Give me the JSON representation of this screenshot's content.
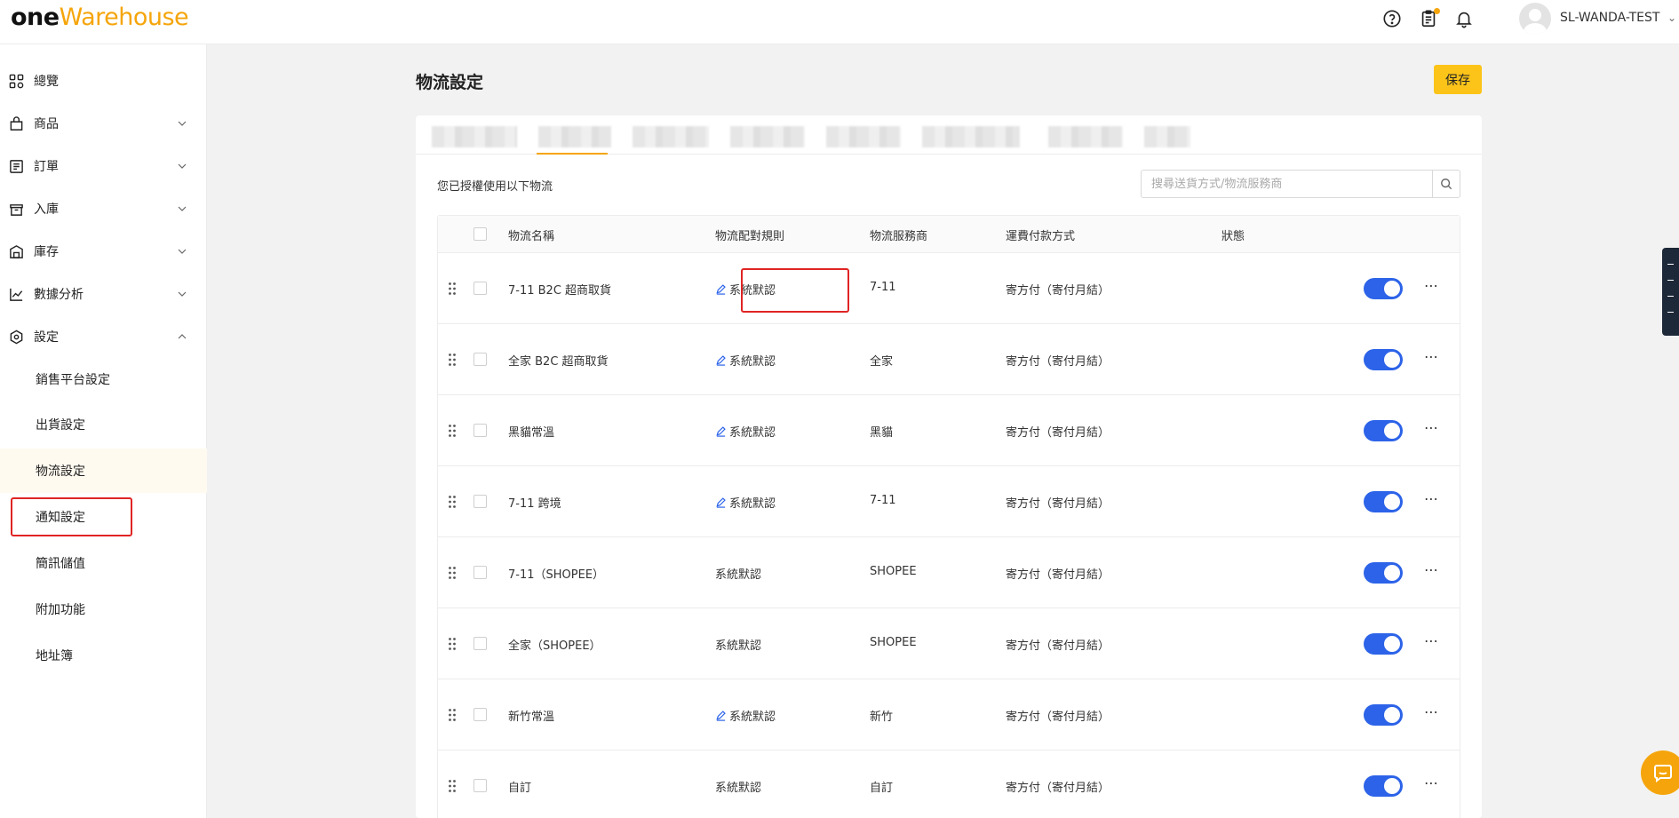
{
  "app": {
    "logo_one": "one",
    "logo_warehouse": "Warehouse",
    "username": "SL-WANDA-TEST",
    "accent": "#f5a50b"
  },
  "header_icons": [
    "help-icon",
    "clipboard-icon",
    "bell-icon"
  ],
  "sidebar": {
    "items": [
      {
        "label": "總覽",
        "icon": "overview-icon",
        "expandable": false
      },
      {
        "label": "商品",
        "icon": "product-icon",
        "expandable": true
      },
      {
        "label": "訂單",
        "icon": "order-icon",
        "expandable": true
      },
      {
        "label": "入庫",
        "icon": "inbound-icon",
        "expandable": true
      },
      {
        "label": "庫存",
        "icon": "inventory-icon",
        "expandable": true
      },
      {
        "label": "數據分析",
        "icon": "analytics-icon",
        "expandable": true
      },
      {
        "label": "設定",
        "icon": "settings-icon",
        "expandable": true,
        "expanded": true
      }
    ],
    "sub_items": [
      {
        "label": "銷售平台設定"
      },
      {
        "label": "出貨設定"
      },
      {
        "label": "物流設定",
        "active": true
      },
      {
        "label": "通知設定"
      },
      {
        "label": "簡訊儲值"
      },
      {
        "label": "附加功能"
      },
      {
        "label": "地址簿"
      }
    ]
  },
  "main": {
    "title": "物流設定",
    "save_label": "保存",
    "authorized_text": "您已授權使用以下物流",
    "search_placeholder": "搜尋送貨方式/物流服務商",
    "columns": {
      "name": "物流名稱",
      "rule": "物流配對規則",
      "provider": "物流服務商",
      "payment": "運費付款方式",
      "status": "狀態"
    },
    "rows": [
      {
        "name": "7-11 B2C 超商取貨",
        "rule": "系統默認",
        "rule_editable": true,
        "provider": "7-11",
        "payment": "寄方付（寄付月結）",
        "enabled": true
      },
      {
        "name": "全家 B2C 超商取貨",
        "rule": "系統默認",
        "rule_editable": true,
        "provider": "全家",
        "payment": "寄方付（寄付月結）",
        "enabled": true
      },
      {
        "name": "黑貓常溫",
        "rule": "系統默認",
        "rule_editable": true,
        "provider": "黑貓",
        "payment": "寄方付（寄付月結）",
        "enabled": true
      },
      {
        "name": "7-11 跨境",
        "rule": "系統默認",
        "rule_editable": true,
        "provider": "7-11",
        "payment": "寄方付（寄付月結）",
        "enabled": true
      },
      {
        "name": "7-11（SHOPEE）",
        "rule": "系統默認",
        "rule_editable": false,
        "provider": "SHOPEE",
        "payment": "寄方付（寄付月結）",
        "enabled": true
      },
      {
        "name": "全家（SHOPEE）",
        "rule": "系統默認",
        "rule_editable": false,
        "provider": "SHOPEE",
        "payment": "寄方付（寄付月結）",
        "enabled": true
      },
      {
        "name": "新竹常溫",
        "rule": "系統默認",
        "rule_editable": true,
        "provider": "新竹",
        "payment": "寄方付（寄付月結）",
        "enabled": true
      },
      {
        "name": "自訂",
        "rule": "系統默認",
        "rule_editable": false,
        "provider": "自訂",
        "payment": "寄方付（寄付月結）",
        "enabled": true
      }
    ]
  }
}
